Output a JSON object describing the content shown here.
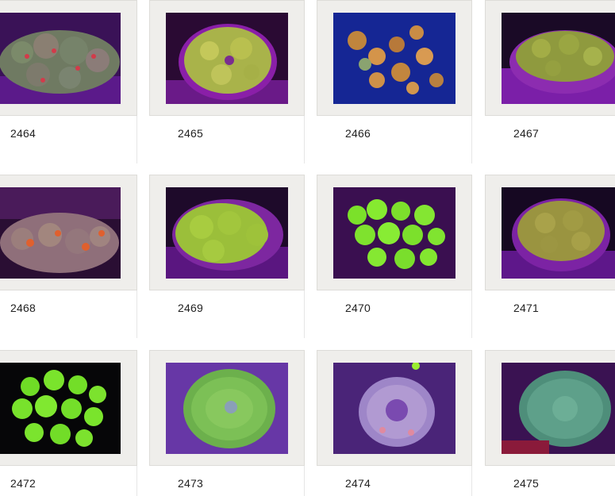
{
  "gallery": {
    "items": [
      {
        "label": "2464",
        "image": "coral-photo"
      },
      {
        "label": "2465",
        "image": "coral-photo"
      },
      {
        "label": "2466",
        "image": "coral-photo"
      },
      {
        "label": "2467",
        "image": "coral-photo"
      },
      {
        "label": "2468",
        "image": "coral-photo"
      },
      {
        "label": "2469",
        "image": "coral-photo"
      },
      {
        "label": "2470",
        "image": "coral-photo"
      },
      {
        "label": "2471",
        "image": "coral-photo"
      },
      {
        "label": "2472",
        "image": "coral-photo"
      },
      {
        "label": "2473",
        "image": "coral-photo"
      },
      {
        "label": "2474",
        "image": "coral-photo"
      },
      {
        "label": "2475",
        "image": "coral-photo"
      }
    ]
  },
  "colors": {
    "card_bg": "#efeeeb",
    "photo_bg": "#0a0612",
    "label_text": "#222222"
  }
}
